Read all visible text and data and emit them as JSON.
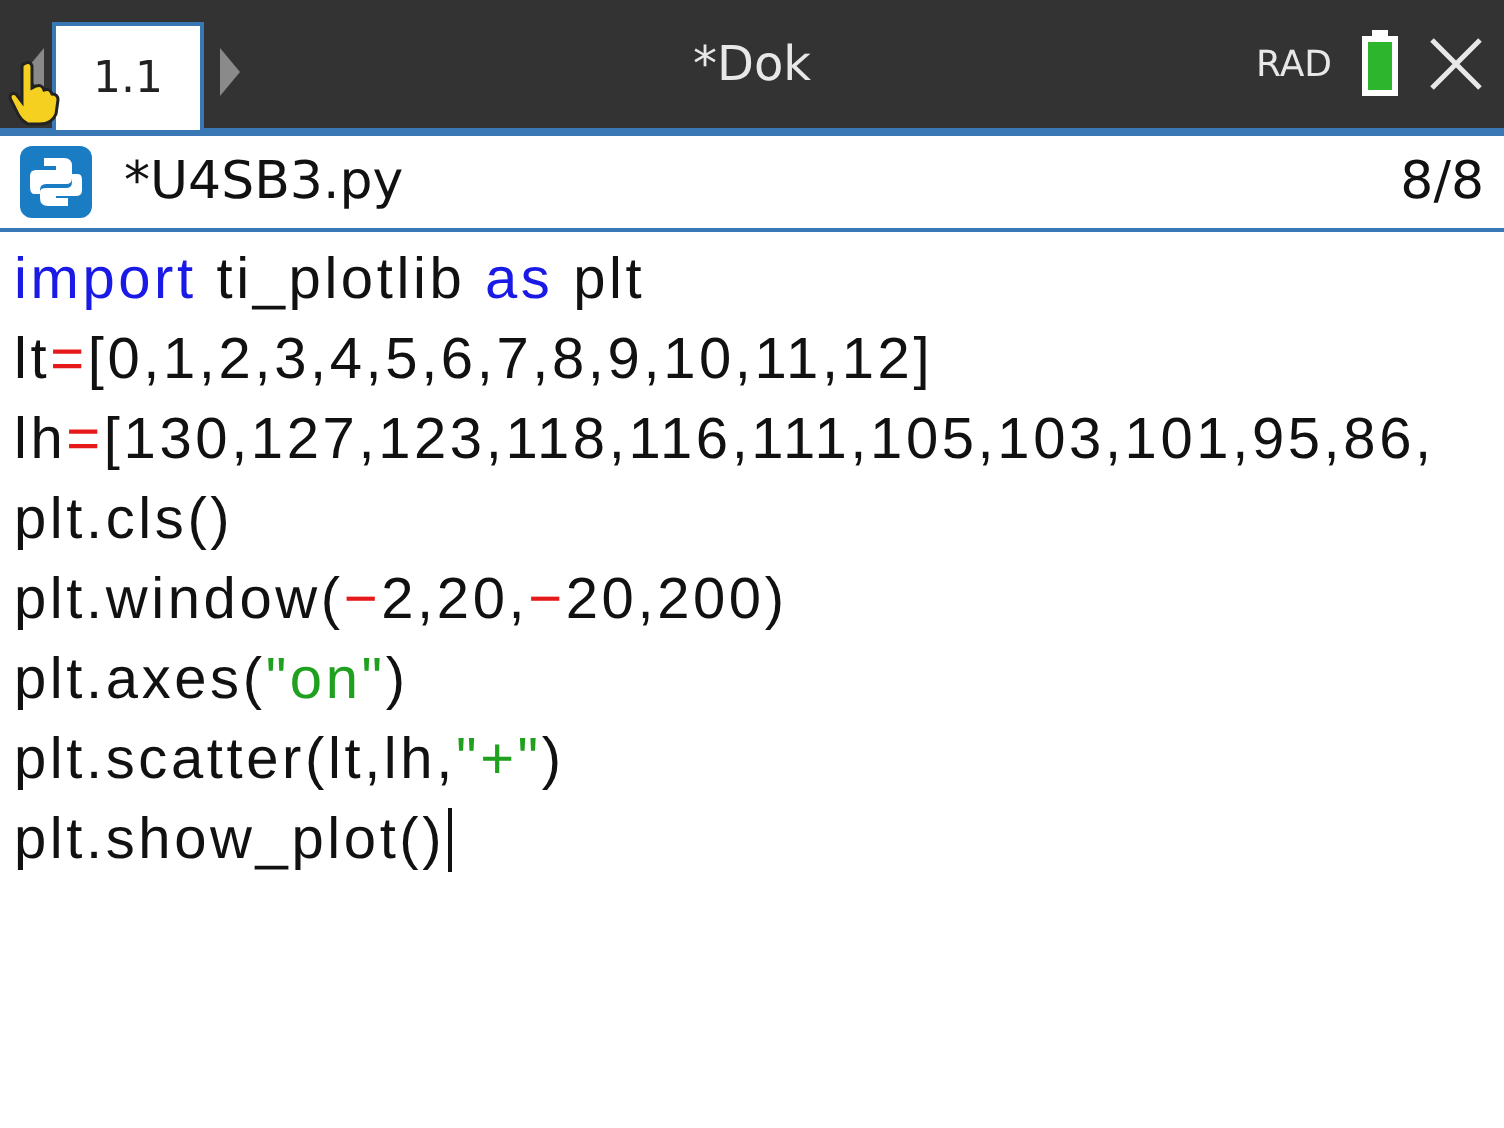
{
  "top_bar": {
    "tab": {
      "label": "1.1",
      "selected": true
    },
    "title": "*Dok",
    "angle_mode": "RAD"
  },
  "editor": {
    "file_name": "*U4SB3.py",
    "position": "8/8",
    "lines": [
      [
        {
          "kind": "keyword",
          "text": "import"
        },
        {
          "kind": "plain",
          "text": " ti_plotlib "
        },
        {
          "kind": "keyword",
          "text": "as"
        },
        {
          "kind": "plain",
          "text": " plt"
        }
      ],
      [
        {
          "kind": "plain",
          "text": "lt"
        },
        {
          "kind": "operator",
          "text": "="
        },
        {
          "kind": "plain",
          "text": "[0,1,2,3,4,5,6,7,8,9,10,11,12]"
        }
      ],
      [
        {
          "kind": "plain",
          "text": "lh"
        },
        {
          "kind": "operator",
          "text": "="
        },
        {
          "kind": "plain",
          "text": "[130,127,123,118,116,111,105,103,101,95,86,"
        }
      ],
      [
        {
          "kind": "plain",
          "text": "plt.cls()"
        }
      ],
      [
        {
          "kind": "plain",
          "text": "plt.window("
        },
        {
          "kind": "operator",
          "text": "−"
        },
        {
          "kind": "plain",
          "text": "2,20,"
        },
        {
          "kind": "operator",
          "text": "−"
        },
        {
          "kind": "plain",
          "text": "20,200)"
        }
      ],
      [
        {
          "kind": "plain",
          "text": "plt.axes("
        },
        {
          "kind": "string",
          "text": "\"on\""
        },
        {
          "kind": "plain",
          "text": ")"
        }
      ],
      [
        {
          "kind": "plain",
          "text": "plt.scatter(lt,lh,"
        },
        {
          "kind": "string",
          "text": "\"+\""
        },
        {
          "kind": "plain",
          "text": ")"
        }
      ],
      [
        {
          "kind": "plain",
          "text": "plt.show_plot()"
        }
      ]
    ]
  }
}
